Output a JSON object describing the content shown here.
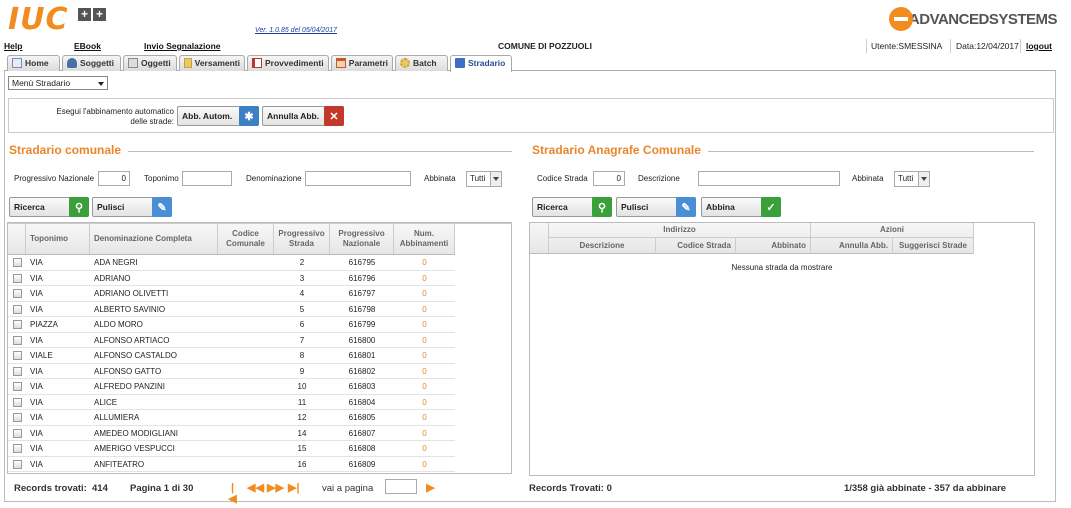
{
  "header": {
    "logo_text": "IUC",
    "logo_plus": "+",
    "version": "Ver. 1.0.85 del 05/04/2017",
    "vendor": "ADVANCEDSYSTEMS"
  },
  "menubar": {
    "help": "Help",
    "ebook": "EBook",
    "invio": "Invio Segnalazione",
    "comune": "COMUNE DI POZZUOLI",
    "utente": "Utente:SMESSINA",
    "data": "Data:12/04/2017",
    "logout": "logout"
  },
  "tabs": [
    {
      "label": "Home",
      "icon": "home-icon",
      "color": "#7a8ea8"
    },
    {
      "label": "Soggetti",
      "icon": "user-icon",
      "color": "#4a6fa5"
    },
    {
      "label": "Oggetti",
      "icon": "document-icon",
      "color": "#8a8a8a"
    },
    {
      "label": "Versamenti",
      "icon": "money-icon",
      "color": "#c9a13a"
    },
    {
      "label": "Provvedimenti",
      "icon": "stamp-icon",
      "color": "#b33"
    },
    {
      "label": "Parametri",
      "icon": "calendar-icon",
      "color": "#c25a2a"
    },
    {
      "label": "Batch",
      "icon": "gear-icon",
      "color": "#c9a13a"
    },
    {
      "label": "Stradario",
      "icon": "road-sign-icon",
      "color": "#3a6fc4"
    }
  ],
  "menu_select": "Menù Stradario",
  "auto_match": {
    "label": "Esegui l'abbinamento automatico delle strade:",
    "auto_btn": "Abb. Autom.",
    "cancel_btn": "Annulla Abb."
  },
  "left": {
    "title": "Stradario comunale",
    "filters": {
      "progressivo_label": "Progressivo Nazionale",
      "progressivo_value": "0",
      "toponimo_label": "Toponimo",
      "toponimo_value": "",
      "denominazione_label": "Denominazione",
      "denominazione_value": "",
      "abbinata_label": "Abbinata",
      "abbinata_value": "Tutti"
    },
    "search_btn": "Ricerca",
    "clear_btn": "Pulisci",
    "columns": [
      "Toponimo",
      "Denominazione Completa",
      "Codice Comunale",
      "Progressivo Strada",
      "Progressivo Nazionale",
      "Num. Abbinamenti"
    ],
    "rows": [
      {
        "toponimo": "VIA",
        "denominazione": "ADA NEGRI",
        "codice": "",
        "prog_strada": "2",
        "prog_naz": "616795",
        "num": "0"
      },
      {
        "toponimo": "VIA",
        "denominazione": "ADRIANO",
        "codice": "",
        "prog_strada": "3",
        "prog_naz": "616796",
        "num": "0"
      },
      {
        "toponimo": "VIA",
        "denominazione": "ADRIANO OLIVETTI",
        "codice": "",
        "prog_strada": "4",
        "prog_naz": "616797",
        "num": "0"
      },
      {
        "toponimo": "VIA",
        "denominazione": "ALBERTO SAVINIO",
        "codice": "",
        "prog_strada": "5",
        "prog_naz": "616798",
        "num": "0"
      },
      {
        "toponimo": "PIAZZA",
        "denominazione": "ALDO MORO",
        "codice": "",
        "prog_strada": "6",
        "prog_naz": "616799",
        "num": "0"
      },
      {
        "toponimo": "VIA",
        "denominazione": "ALFONSO ARTIACO",
        "codice": "",
        "prog_strada": "7",
        "prog_naz": "616800",
        "num": "0"
      },
      {
        "toponimo": "VIALE",
        "denominazione": "ALFONSO CASTALDO",
        "codice": "",
        "prog_strada": "8",
        "prog_naz": "616801",
        "num": "0"
      },
      {
        "toponimo": "VIA",
        "denominazione": "ALFONSO GATTO",
        "codice": "",
        "prog_strada": "9",
        "prog_naz": "616802",
        "num": "0"
      },
      {
        "toponimo": "VIA",
        "denominazione": "ALFREDO PANZINI",
        "codice": "",
        "prog_strada": "10",
        "prog_naz": "616803",
        "num": "0"
      },
      {
        "toponimo": "VIA",
        "denominazione": "ALICE",
        "codice": "",
        "prog_strada": "11",
        "prog_naz": "616804",
        "num": "0"
      },
      {
        "toponimo": "VIA",
        "denominazione": "ALLUMIERA",
        "codice": "",
        "prog_strada": "12",
        "prog_naz": "616805",
        "num": "0"
      },
      {
        "toponimo": "VIA",
        "denominazione": "AMEDEO MODIGLIANI",
        "codice": "",
        "prog_strada": "14",
        "prog_naz": "616807",
        "num": "0"
      },
      {
        "toponimo": "VIA",
        "denominazione": "AMERIGO VESPUCCI",
        "codice": "",
        "prog_strada": "15",
        "prog_naz": "616808",
        "num": "0"
      },
      {
        "toponimo": "VIA",
        "denominazione": "ANFITEATRO",
        "codice": "",
        "prog_strada": "16",
        "prog_naz": "616809",
        "num": "0"
      }
    ],
    "records": "Records trovati:",
    "records_count": "414",
    "page_info": "Pagina 1 di 30",
    "goto_label": "vai a pagina",
    "goto_value": ""
  },
  "right": {
    "title": "Stradario Anagrafe Comunale",
    "filters": {
      "codice_label": "Codice Strada",
      "codice_value": "0",
      "descrizione_label": "Descrizione",
      "descrizione_value": "",
      "abbinata_label": "Abbinata",
      "abbinata_value": "Tutti"
    },
    "search_btn": "Ricerca",
    "clear_btn": "Pulisci",
    "match_btn": "Abbina",
    "group_indirizzo": "Indirizzo",
    "group_azioni": "Azioni",
    "columns": [
      "Descrizione",
      "Codice Strada",
      "Abbinato",
      "Annulla Abb.",
      "Suggerisci Strade"
    ],
    "empty": "Nessuna strada da mostrare",
    "records": "Records Trovati: 0",
    "summary": "1/358 già abbinate - 357 da abbinare"
  }
}
